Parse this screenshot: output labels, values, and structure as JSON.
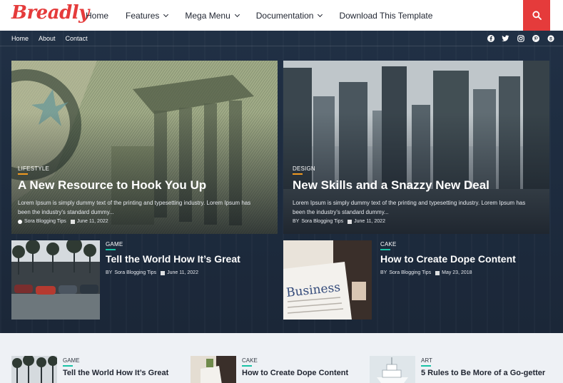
{
  "brand": {
    "logo": "Breadly",
    "accent": "#e53b3b"
  },
  "nav": {
    "items": [
      {
        "label": "Home",
        "dropdown": false
      },
      {
        "label": "Features",
        "dropdown": true
      },
      {
        "label": "Mega Menu",
        "dropdown": true
      },
      {
        "label": "Documentation",
        "dropdown": true
      },
      {
        "label": "Download This Template",
        "dropdown": false
      }
    ],
    "search_icon": "search-icon"
  },
  "subnav": {
    "links": [
      "Home",
      "About",
      "Contact"
    ],
    "social_icons": [
      "facebook-icon",
      "twitter-icon",
      "instagram-icon",
      "pinterest-icon",
      "skype-icon"
    ]
  },
  "featured": [
    {
      "tag": "Lifestyle",
      "tag_color": "#f29a1f",
      "title": "A New Resource to Hook You Up",
      "excerpt_line1": "Lorem Ipsum is simply dummy text of the printing and typesetting industry. Lorem Ipsum has",
      "excerpt_line2": "been the industry's standard dummy...",
      "author": "Sora Blogging Tips",
      "date": "June 11, 2022"
    },
    {
      "tag": "Design",
      "tag_color": "#f29a1f",
      "title": "New Skills and a Snazzy New Deal",
      "excerpt_line1": "Lorem Ipsum is simply dummy text of the printing and typesetting industry. Lorem Ipsum has",
      "excerpt_line2": "been the industry's standard dummy...",
      "author_prefix": "BY",
      "author": "Sora Blogging Tips",
      "date": "June 11, 2022"
    }
  ],
  "secondary": [
    {
      "tag": "Game",
      "tag_color": "#19c3a6",
      "title": "Tell the World How It’s Great",
      "author_prefix": "BY",
      "author": "Sora Blogging Tips",
      "date": "June 11, 2022"
    },
    {
      "tag": "Cake",
      "tag_color": "#19c3a6",
      "title": "How to Create Dope Content",
      "author_prefix": "BY",
      "author": "Sora Blogging Tips",
      "date": "May 23, 2018"
    }
  ],
  "paper_text": "Business",
  "bottom_list": [
    {
      "tag": "Game",
      "title": "Tell the World How It’s Great",
      "bar_color": "#19c3a6"
    },
    {
      "tag": "Cake",
      "title": "How to Create Dope Content",
      "bar_color": "#19c3a6"
    },
    {
      "tag": "Art",
      "title": "5 Rules to Be More of a Go-getter",
      "bar_color": "#19c3a6"
    }
  ]
}
